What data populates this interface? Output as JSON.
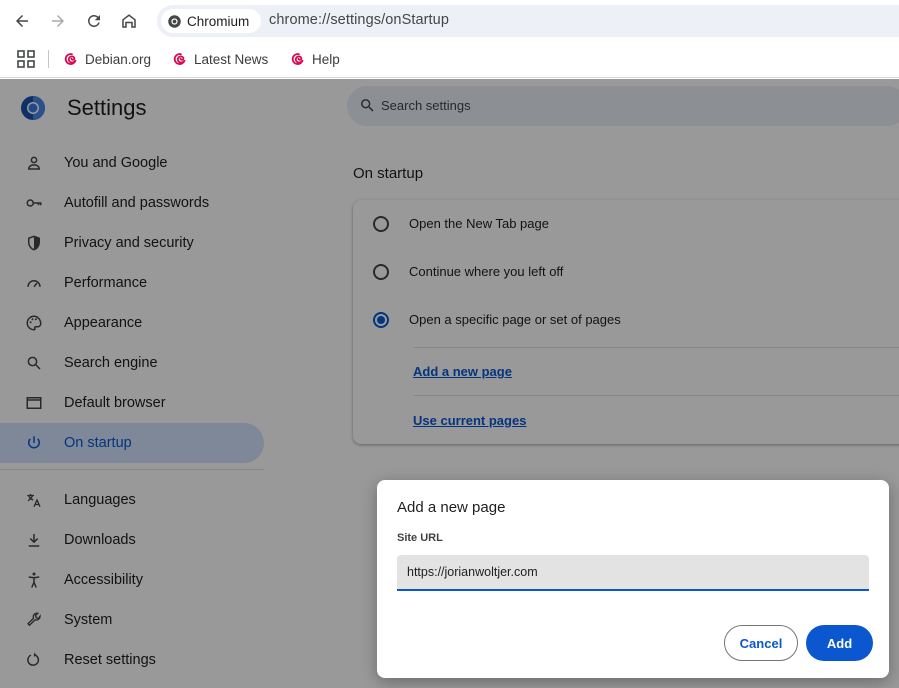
{
  "browser": {
    "chip_label": "Chromium",
    "url": "chrome://settings/onStartup",
    "bookmarks": [
      {
        "label": "Debian.org"
      },
      {
        "label": "Latest News"
      },
      {
        "label": "Help"
      }
    ]
  },
  "settings": {
    "title": "Settings",
    "search_placeholder": "Search settings",
    "nav": [
      {
        "label": "You and Google",
        "icon": "person-icon"
      },
      {
        "label": "Autofill and passwords",
        "icon": "key-icon"
      },
      {
        "label": "Privacy and security",
        "icon": "shield-icon"
      },
      {
        "label": "Performance",
        "icon": "speedometer-icon"
      },
      {
        "label": "Appearance",
        "icon": "palette-icon"
      },
      {
        "label": "Search engine",
        "icon": "search-icon"
      },
      {
        "label": "Default browser",
        "icon": "browser-window-icon"
      },
      {
        "label": "On startup",
        "icon": "power-icon",
        "active": true
      },
      {
        "label": "Languages",
        "icon": "translate-icon"
      },
      {
        "label": "Downloads",
        "icon": "download-icon"
      },
      {
        "label": "Accessibility",
        "icon": "accessibility-icon"
      },
      {
        "label": "System",
        "icon": "wrench-icon"
      },
      {
        "label": "Reset settings",
        "icon": "reset-icon"
      }
    ],
    "section_title": "On startup",
    "options": [
      {
        "label": "Open the New Tab page",
        "checked": false
      },
      {
        "label": "Continue where you left off",
        "checked": false
      },
      {
        "label": "Open a specific page or set of pages",
        "checked": true
      }
    ],
    "links": {
      "add_page": "Add a new page",
      "use_current": "Use current pages"
    }
  },
  "dialog": {
    "title": "Add a new page",
    "field_label": "Site URL",
    "url_value": "https://jorianwoltjer.com",
    "cancel_label": "Cancel",
    "add_label": "Add"
  },
  "colors": {
    "accent": "#0b57d0",
    "active_nav_bg": "#d3e3fd",
    "omnibox_bg": "#edf0f6"
  }
}
